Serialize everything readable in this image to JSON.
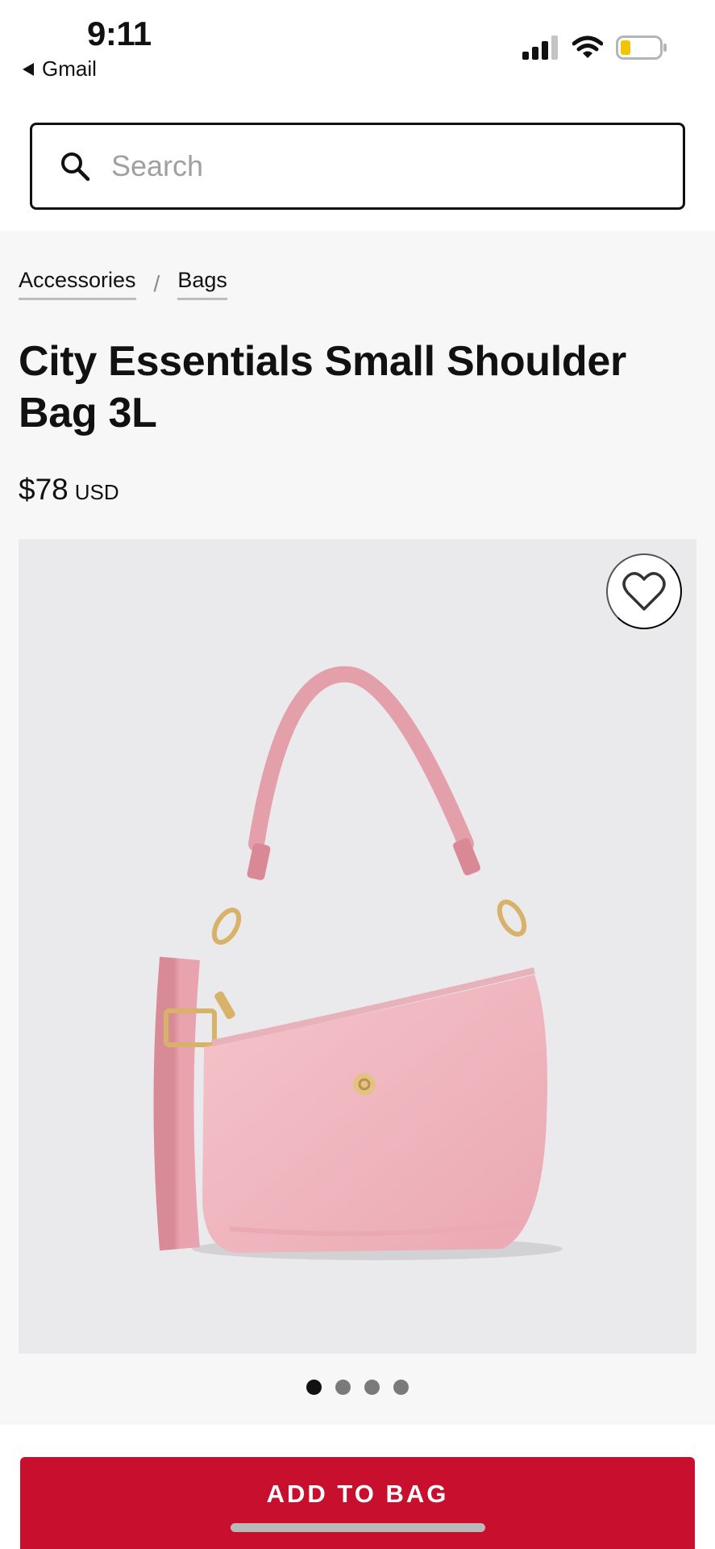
{
  "status_bar": {
    "time": "9:11",
    "back_app": "Gmail",
    "icons": [
      "cellular-signal-icon",
      "wifi-icon",
      "battery-low-icon"
    ],
    "battery_color": "#f5c400"
  },
  "search": {
    "placeholder": "Search",
    "value": "",
    "icon": "search-icon"
  },
  "breadcrumb": {
    "items": [
      "Accessories",
      "Bags"
    ],
    "separator": "/"
  },
  "product": {
    "title": "City Essentials Small Shoulder Bag 3L",
    "price": "$78",
    "currency": "USD",
    "wishlist_icon": "heart-outline-icon",
    "image_count": 4,
    "active_image": 1
  },
  "cta": {
    "label": "ADD TO BAG",
    "color": "#c8102e"
  }
}
